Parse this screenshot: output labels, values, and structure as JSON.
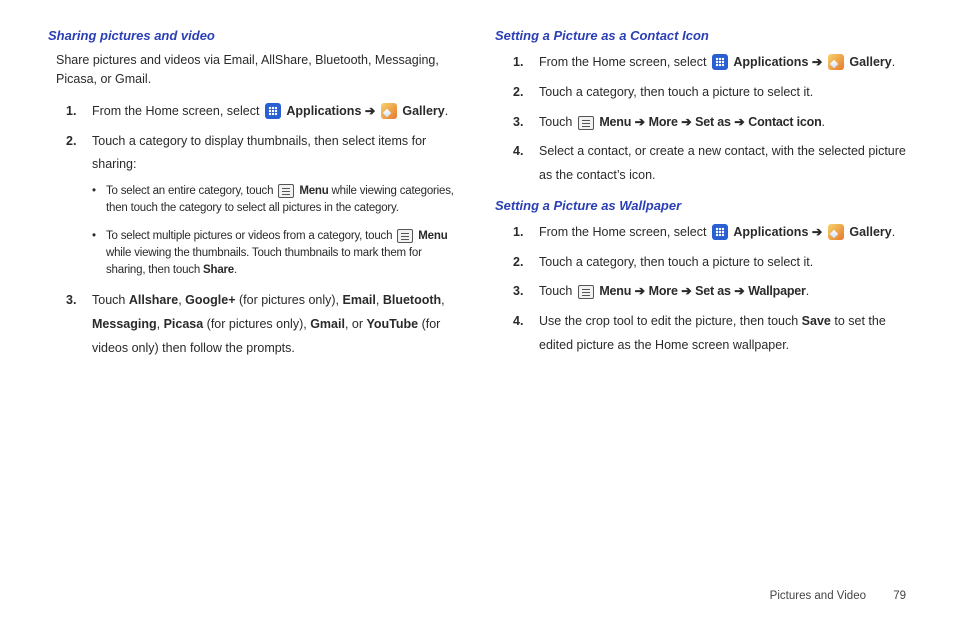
{
  "arrow": "➔",
  "left": {
    "h1": "Sharing pictures and video",
    "intro": "Share pictures and videos via Email, AllShare, Bluetooth, Messaging, Picasa, or Gmail.",
    "s1a": "From the Home screen, select",
    "apps": "Applications",
    "gallery": "Gallery",
    "s2": "Touch a category to display thumbnails, then select items for sharing:",
    "b1a": "To select an entire category, touch",
    "menu": "Menu",
    "b1b": "while viewing categories, then touch the category to select all pictures in the category.",
    "b2a": "To select multiple pictures or videos from a category, touch",
    "b2b": "while viewing the thumbnails. Touch thumbnails to mark them for sharing, then touch",
    "share": "Share",
    "s3a": "Touch",
    "allshare": "Allshare",
    "gplus": "Google+",
    "gplus_note": "(for pictures only),",
    "email": "Email",
    "bt": "Bluetooth",
    "msg": "Messaging",
    "picasa": "Picasa",
    "picasa_note": "(for pictures only),",
    "gmail": "Gmail",
    "or": ", or",
    "yt": "YouTube",
    "yt_note": "(for videos only) then follow the prompts."
  },
  "right": {
    "h1": "Setting a Picture as a Contact Icon",
    "s1a": "From the Home screen, select",
    "apps": "Applications",
    "gallery": "Gallery",
    "s2": "Touch a category, then touch a picture to select it.",
    "s3a": "Touch",
    "menu": "Menu",
    "more": "More",
    "setas": "Set as",
    "contacticon": "Contact icon",
    "s4": "Select a contact, or create a new contact, with the selected picture as the contact’s icon.",
    "h2": "Setting a Picture as Wallpaper",
    "w_s1a": "From the Home screen, select",
    "w_s2": "Touch a category, then touch a picture to select it.",
    "w_s3a": "Touch",
    "wallpaper": "Wallpaper",
    "w_s4a": "Use the crop tool to edit the picture, then touch",
    "save": "Save",
    "w_s4b": "to set the edited picture as the Home screen wallpaper."
  },
  "footer": {
    "section": "Pictures and Video",
    "page": "79"
  }
}
